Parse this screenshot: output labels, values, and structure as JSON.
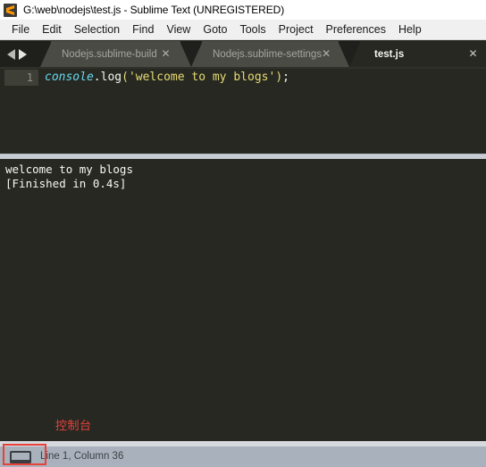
{
  "window": {
    "title": "G:\\web\\nodejs\\test.js - Sublime Text (UNREGISTERED)",
    "logo_icon": "sublime-text-logo-icon"
  },
  "menubar": {
    "items": [
      {
        "label": "File"
      },
      {
        "label": "Edit"
      },
      {
        "label": "Selection"
      },
      {
        "label": "Find"
      },
      {
        "label": "View"
      },
      {
        "label": "Goto"
      },
      {
        "label": "Tools"
      },
      {
        "label": "Project"
      },
      {
        "label": "Preferences"
      },
      {
        "label": "Help"
      }
    ]
  },
  "tabbar": {
    "nav_prev_icon": "chevron-left-icon",
    "nav_next_icon": "chevron-right-icon",
    "close_icon": "close-icon",
    "tabs": [
      {
        "label": "Nodejs.sublime-build",
        "active": false
      },
      {
        "label": "Nodejs.sublime-settings",
        "active": false
      },
      {
        "label": "test.js",
        "active": true
      }
    ]
  },
  "editor": {
    "line_number": "1",
    "code": {
      "object": "console",
      "property": ".log",
      "open_paren": "(",
      "string": "'welcome to my blogs'",
      "close_paren": ")",
      "semicolon": ";"
    },
    "full_line": "console.log('welcome to my blogs');"
  },
  "console_panel": {
    "lines": [
      "welcome to my blogs",
      "[Finished in 0.4s]"
    ]
  },
  "annotation": {
    "text": "控制台"
  },
  "statusbar": {
    "icon": "monitor-icon",
    "position_text": "Line 1, Column 36"
  },
  "colors": {
    "editor_background": "#272822",
    "tab_inactive": "#4a4b45",
    "tabbar_background": "#1f201b",
    "statusbar": "#a9b2bc",
    "splitter": "#c8ccd4",
    "annotation_red": "#e8413a",
    "syntax_object": "#66d9ef",
    "syntax_string": "#e6db74",
    "syntax_plain": "#f8f8f2",
    "line_number": "#8f908a"
  }
}
